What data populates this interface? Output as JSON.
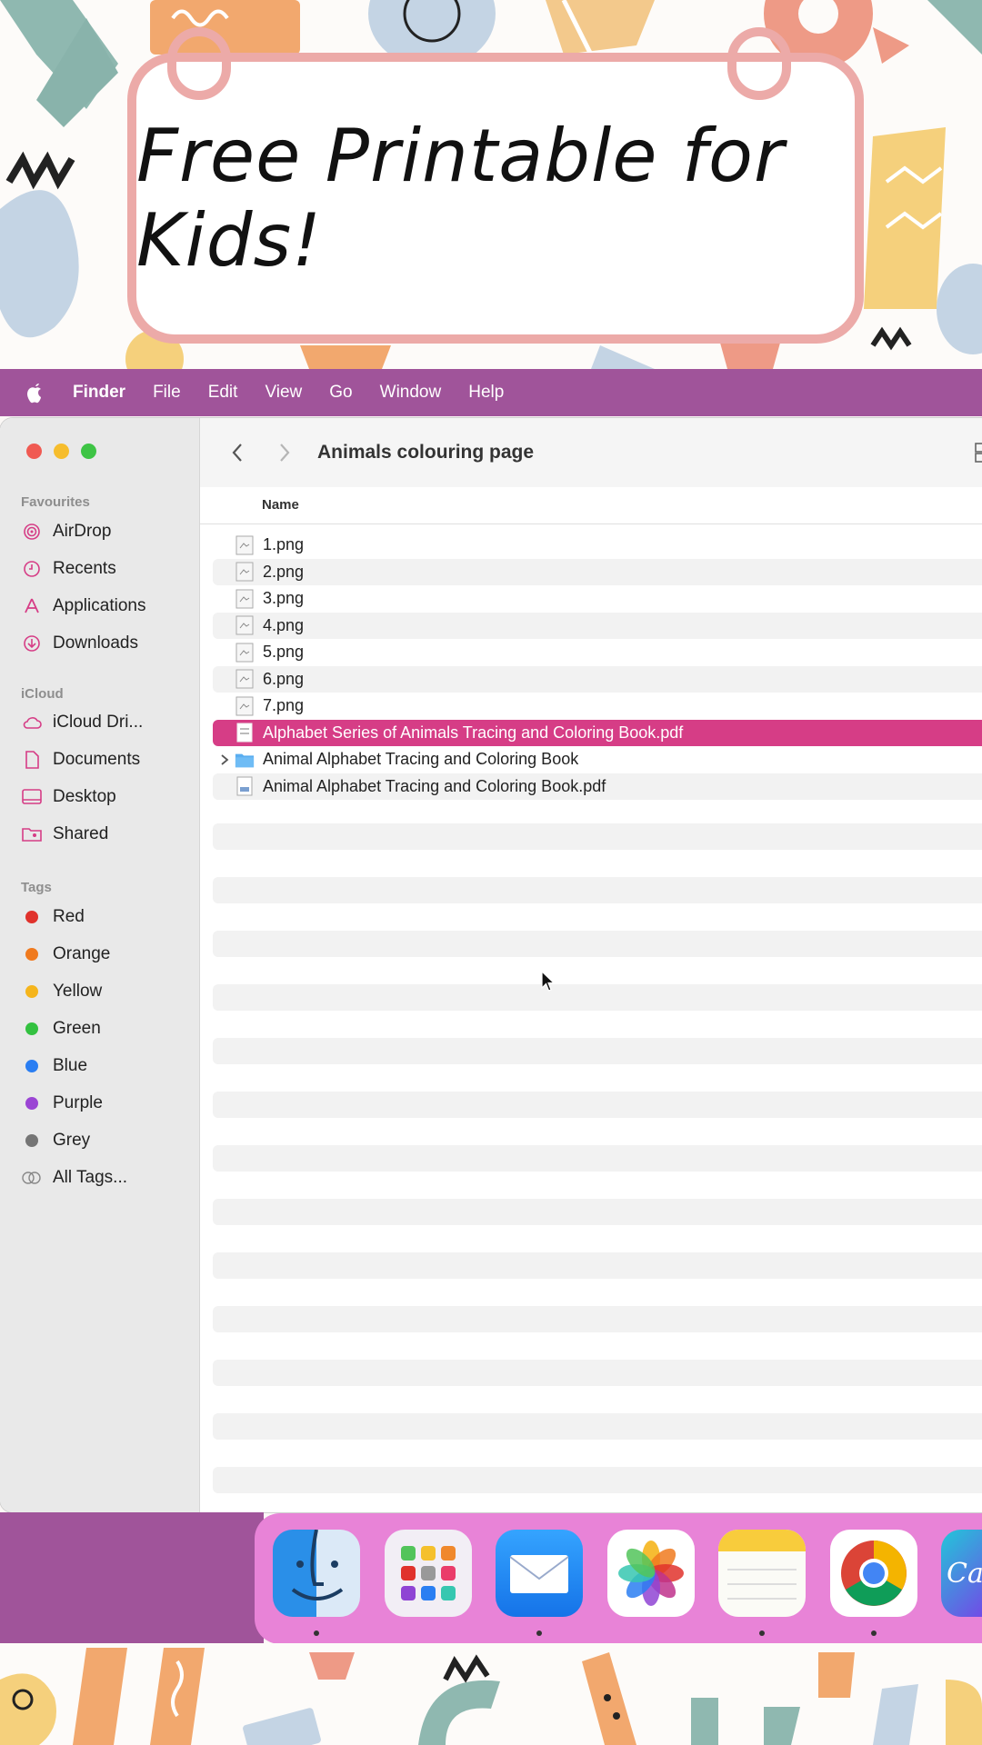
{
  "banner": {
    "title": "Free Printable for Kids!"
  },
  "menubar": {
    "items": [
      "Finder",
      "File",
      "Edit",
      "View",
      "Go",
      "Window",
      "Help"
    ]
  },
  "window": {
    "title": "Animals colouring page",
    "column_header": "Name"
  },
  "sidebar": {
    "favourites_heading": "Favourites",
    "favourites": [
      "AirDrop",
      "Recents",
      "Applications",
      "Downloads"
    ],
    "icloud_heading": "iCloud",
    "icloud": [
      "iCloud Dri...",
      "Documents",
      "Desktop",
      "Shared"
    ],
    "tags_heading": "Tags",
    "tags": [
      {
        "label": "Red",
        "color": "#e0322c"
      },
      {
        "label": "Orange",
        "color": "#f07a1e"
      },
      {
        "label": "Yellow",
        "color": "#f5b51c"
      },
      {
        "label": "Green",
        "color": "#33c140"
      },
      {
        "label": "Blue",
        "color": "#2a7ef2"
      },
      {
        "label": "Purple",
        "color": "#9b45d4"
      },
      {
        "label": "Grey",
        "color": "#757575"
      }
    ],
    "all_tags": "All Tags..."
  },
  "files": [
    {
      "name": "1.png",
      "kind": "image"
    },
    {
      "name": "2.png",
      "kind": "image"
    },
    {
      "name": "3.png",
      "kind": "image"
    },
    {
      "name": "4.png",
      "kind": "image"
    },
    {
      "name": "5.png",
      "kind": "image"
    },
    {
      "name": "6.png",
      "kind": "image"
    },
    {
      "name": "7.png",
      "kind": "image"
    },
    {
      "name": "Alphabet Series of Animals Tracing and Coloring Book.pdf",
      "kind": "pdf",
      "selected": true
    },
    {
      "name": "Animal Alphabet Tracing and Coloring Book",
      "kind": "folder"
    },
    {
      "name": "Animal Alphabet Tracing and Coloring Book.pdf",
      "kind": "pdf"
    }
  ],
  "dock": {
    "apps": [
      "finder-icon",
      "launchpad-icon",
      "mail-icon",
      "photos-icon",
      "notes-icon",
      "chrome-icon",
      "canva-icon"
    ],
    "canva_label": "Ca"
  },
  "colors": {
    "menubar": "#a0549a",
    "selection": "#d63d86",
    "dock": "#e883d7",
    "banner_border": "#ecaaa8"
  }
}
